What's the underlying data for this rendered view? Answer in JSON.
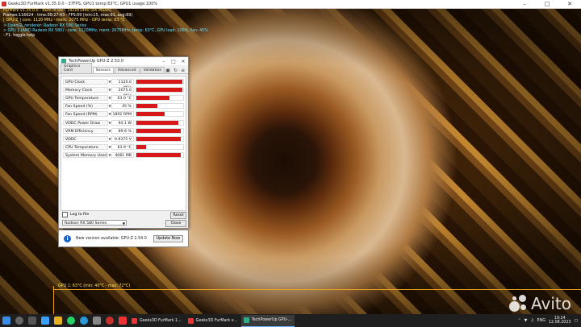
{
  "window": {
    "title": "Geeks3D FurMark v1.35.0.0 - 37FPS, GPU1 temp:63°C, GPU1 usage:100%"
  },
  "osd": {
    "line1": "FurMark v1.35.0.0 - Burn-in test, 1920x1440 (8X MSAA)",
    "line2": "Frames:116624 - time:00:27:43 - FPS:69 (min:15, max:91, avg:69)",
    "line3": "[ GPU-Z ] core: 1120 MHz - mem: 2075 MHz - GPU temp: 63 °C",
    "line4": "> OpenGL renderer: Radeon RX 580 Series",
    "line5": "> GPU 1 (AMD Radeon RX 580) - core: 1120MHz, mem: 2075MHz, temp: 63°C, GPU load: 100%, fan: 45%",
    "line6": "- F1: toggle help"
  },
  "gpuz": {
    "title": "TechPowerUp GPU-Z 2.53.0",
    "tabs": [
      "Graphics Card",
      "Sensors",
      "Advanced",
      "Validation"
    ],
    "active_tab": "Sensors",
    "sensors": [
      {
        "label": "GPU Clock",
        "value": "1120.0 MHz",
        "fill": 0.98
      },
      {
        "label": "Memory Clock",
        "value": "2075.0 MHz",
        "fill": 0.98
      },
      {
        "label": "GPU Temperature",
        "value": "63.0 °C",
        "fill": 0.7
      },
      {
        "label": "Fan Speed (%)",
        "value": "45 %",
        "fill": 0.45
      },
      {
        "label": "Fan Speed (RPM)",
        "value": "1892 RPM",
        "fill": 0.6
      },
      {
        "label": "VDDC Power Draw",
        "value": "94.1 W",
        "fill": 0.9
      },
      {
        "label": "VRM Efficiency",
        "value": "89.6 %",
        "fill": 0.95
      },
      {
        "label": "VDDC",
        "value": "0.9375 V",
        "fill": 0.95
      },
      {
        "label": "CPU Temperature",
        "value": "63.9 °C",
        "fill": 0.2
      },
      {
        "label": "System Memory Used",
        "value": "4081 MB",
        "fill": 0.95
      }
    ],
    "log_to_file": "Log to file",
    "reset": "Reset",
    "gpu_select": "Radeon RX 580 Series",
    "close": "Close"
  },
  "notification": {
    "message": "New version available: GPU-Z 2.54.0",
    "button": "Update Now"
  },
  "graph": {
    "label": "GPU 1: 63°C (min: 40°C - max: 72°C)"
  },
  "watermark": "Avito",
  "taskbar": {
    "apps": [
      "Geeks3D FurMark 1...",
      "Geeks3D FurMark v...",
      "TechPowerUp GPU-..."
    ],
    "lang": "ENG",
    "time": "19:24",
    "date": "12.08.2023"
  },
  "colors": {
    "bar_fill": "#d81818",
    "osd_yellow": "#ffe066",
    "osd_cyan": "#66e0ff"
  }
}
